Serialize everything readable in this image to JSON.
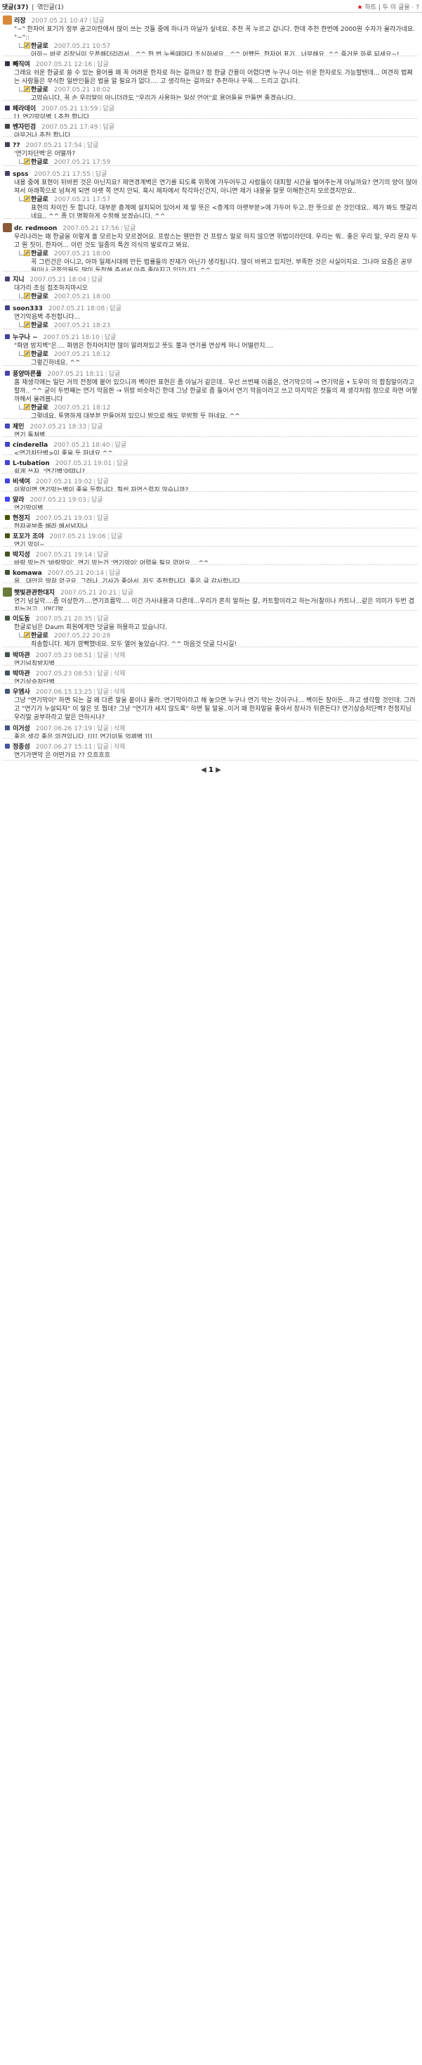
{
  "topbar": {
    "tab_comments": "댓글(37)",
    "tab_sep": "|",
    "tab_trackback": "엮인글(1)",
    "heart": "★",
    "heart_label": "하트",
    "share": "| 두 이 글을 · ?"
  },
  "comments": [
    {
      "nick": "리장",
      "date": "2007.05.21 10:47",
      "reply_link": "답글",
      "avatar": "#d88a3a",
      "text": "\"~\" 한자어 표기가 정부 공고이란에서 많이 쓰는 것들 중에 하나가 아닐가 싶네요. 추천 꼭 누르고 갑니다. 한데 추천 한번에 2000원 수자가 올라가네요. \"~\"::",
      "reply": {
        "nick": "한글로",
        "date": "2007.05.21 10:57",
        "text": "아하~ 바로 리장님이 오픈해더리라서.. ^^ 한 번 누를때마다 조심하세요.. ^^ 어쨌든. 한자어 표기.. 너무해요. ^^ 즐거운 하루 되세요~!"
      }
    },
    {
      "nick": "빼직여",
      "date": "2007.05.21 12:16",
      "reply_link": "답글",
      "avatar": "#334",
      "text": "그래요 쉬운 한글로 쓸 수 있는 용어를 왜 꼭 어려운 한자로 하는 걸까요? 정 한글 간용이 어렵다면 누구나 아는 쉬운 한자로도 가능할텐데... 여견히 법쪄는 사람들은 무식한 일반인들은 법을 알 필요가 없다.... 고 생각하는 걸까요? 추천하나 꾸욱... 드리고 갑니다.",
      "reply": {
        "nick": "한글로",
        "date": "2007.05.21 18:02",
        "text": "고맙습니다. 꼭 손 우리말이 아니더라도 \"우리가 사용하는 일상 언어\"로 용어들을 만들면 좋겠습니다."
      }
    },
    {
      "nick": "페라데이",
      "date": "2007.05.21 13:59",
      "reply_link": "답글",
      "avatar": "#335",
      "text": "[1.연기막이벽 ] 추천 합니다.",
      "reply": null
    },
    {
      "nick": "벤자민검",
      "date": "2007.05.21 17:49",
      "reply_link": "답글",
      "avatar": "#444",
      "text": "아무거나 추천 합니다.",
      "reply": null
    },
    {
      "nick": "??",
      "date": "2007.05.21 17:54",
      "reply_link": "답글",
      "avatar": "#445",
      "text": "'연기차단벽'은 어떨까?",
      "reply": {
        "nick": "한글로",
        "date": "2007.05.21 17:59",
        "text": "그것도 괜찮네요"
      }
    },
    {
      "nick": "spss",
      "date": "2007.05.21 17:55",
      "reply_link": "답글",
      "avatar": "#446",
      "text": "내용 중에 표현이 뒤바뀐 것은 아닌지요? 제연경계벽은 연기를 되도록 위쪽에 가두어두고 사람들이 대피할 시간을 벌어주는게 아닐까요? 연기의 양이 많아져서 아래쪽으로 넘쳐게 되면 아랫 쪽 연지 안되. 혹시 제자에서 착각하신건지, 아니면 제가 내용을 잘못 이해한건지 모르겠지만요..",
      "reply": {
        "nick": "한글로",
        "date": "2007.05.21 17:57",
        "text": "표현의 차이인 듯 합니다. 대부분 충계에 설치되어 있어서 제 말 뜻은 <층계의 아랫부분>에 가두어 두고..란 뜻으로 쓴 것인데요.. 제가 봐도 헷갈리네요.. ^^ 좀 더 명확하게 수정해 보겠습니다. ^^"
      }
    },
    {
      "nick": "dr. redmoon",
      "date": "2007.05.21 17:56",
      "reply_link": "답글",
      "avatar": "#8a5a3a",
      "text": "우리나라는 왜 한글을 이렇게 홀 모르는지 모르겠어요. 프랑스는 웬만한 건 프랑스 말로 하지 않으면 위법이라던데. 우리는 뭐.. 좋은 우리 말, 우리 문자 두고 뭔 짓이. 한자어... 이런 것도 일종의 특권 의식의 발로라고 봐요.",
      "reply": {
        "nick": "한글로",
        "date": "2007.05.21 18:00",
        "text": "꼭 그런건은 아니고, 아마 일제시대에 만든 법률들의 잔재가 아닌가 생각됩니다. 많이 바뀌고 있지만, 부족한 것은 사실이지요. 그나마 요즘은 공무원이나 국회의원도 많이 동참해 주셔서 아주 좋아지고 있답니다. ^^"
      }
    },
    {
      "nick": "지니",
      "date": "2007.05.21 18:04",
      "reply_link": "답글",
      "avatar": "#447",
      "text": "대가리 조심 접조하지마시오",
      "reply": {
        "nick": "한글로",
        "date": "2007.05.21 18:00",
        "text": "크... 주의하라는 뜻은 색깔만 봐도.. ^^"
      }
    },
    {
      "nick": "soon333",
      "date": "2007.05.21 18:08",
      "reply_link": "답글",
      "avatar": "#448",
      "text": "연기막음벽 추천합니다...",
      "reply": {
        "nick": "한글로",
        "date": "2007.05.21 18:23",
        "text": "네.. 무난하지요? ^^"
      }
    },
    {
      "nick": "누구나 ~",
      "date": "2007.05.21 18:10",
      "reply_link": "답글",
      "avatar": "#449",
      "text": "\"화염 방지벽\"은.... 화염은 한자어지만 많이 알려져있고 뜻도 불과 연기를 연상케 하니 어떨런지....",
      "reply": {
        "nick": "한글로",
        "date": "2007.05.21 18:12",
        "text": "그렇긴하네요. ^^"
      }
    },
    {
      "nick": "풍양마른풀",
      "date": "2007.05.21 18:11",
      "reply_link": "답글",
      "avatar": "#44a",
      "text": "홈 제생각에는 일단 거의 전정에 붙어 있으니까 벽이란 표현은 좀 아닐거 같은데.. 우선 쓰번째 이름은, 연기막으미 → 연기막음 • 도우미 의 합침말이라고 할까.. ^^ 굳이 두번째는 연기 막음판 → 위랑 비슷하긴 한데 그냥 한글로 좀 들어서 연기 막음이라고 쓰고 마지막은 컷들의 제 생각처럼 정으로 하면 어떻까해서 올려봅니다",
      "reply": {
        "nick": "한글로",
        "date": "2007.05.21 18:12",
        "text": "그렇네요. 투명하게 대부분 만들어져 있으니 방으로 해도 무방할 듯 하네요. ^^"
      }
    },
    {
      "nick": "제인",
      "date": "2007.05.21 18:33",
      "reply_link": "답글",
      "avatar": "#44b",
      "text": "연기 돌쳐벽..",
      "reply": null
    },
    {
      "nick": "cinderella",
      "date": "2007.05.21 18:40",
      "reply_link": "답글",
      "avatar": "#44c",
      "text": "<연기차단벽>이 좋을 듯 하네요.^^",
      "reply": null
    },
    {
      "nick": "L-tubation",
      "date": "2007.05.21 19:01",
      "reply_link": "답글",
      "avatar": "#44d",
      "text": "쉽게 쓰자. '연긴벽'어떠니?",
      "reply": null
    },
    {
      "nick": "비색여",
      "date": "2007.05.21 19:02",
      "reply_link": "답글",
      "avatar": "#44e",
      "text": "이왕이면 연기막는벽이 좋을 듯합니다. 훨씬 자연스럽지 않습니까?",
      "reply": null
    },
    {
      "nick": "알라",
      "date": "2007.05.21 19:03",
      "reply_link": "답글",
      "avatar": "#44f",
      "text": "연기막이벽",
      "reply": null
    },
    {
      "nick": "현정지",
      "date": "2007.05.21 19:03",
      "reply_link": "답글",
      "avatar": "#450",
      "text": "한자공부좀 해라 해서넘지나",
      "reply": null
    },
    {
      "nick": "포꼬가 조야",
      "date": "2007.05.21 19:06",
      "reply_link": "답글",
      "avatar": "#451",
      "text": "연기 막이~",
      "reply": null
    },
    {
      "nick": "박지성",
      "date": "2007.05.21 19:14",
      "reply_link": "답글",
      "avatar": "#452",
      "text": "바람 막는건 '바람막이', 연기 막는건 '연기막이' 어렵을 필요 없어요....^^",
      "reply": null
    },
    {
      "nick": "komawa",
      "date": "2007.05.21 20:14",
      "reply_link": "답글",
      "avatar": "#453",
      "text": "음.. 대안은 딱히 없구요. 그러나, 기사가 좋아서, 저도 추천합니다. 좋은 글 감사합니다.",
      "reply": null
    },
    {
      "nick": "햇빛관관한대지",
      "date": "2007.05.21 20:21",
      "reply_link": "답글",
      "avatar": "#6a7a3a",
      "text": "연기 넘실막....좀 이상한가....연기흐름막.... 이건 가사내용과 다른데...우리가 흔히 말하는 칼, 카트할이라고 하는거(찰이나 카트나...같은 의미가 두번 겹치는거고...)머디말...",
      "reply": null
    },
    {
      "nick": "이도동",
      "date": "2007.05.21 20:35",
      "reply_link": "답글",
      "avatar": "#454",
      "text": "한글로님은 Daum 회원에게만 덧글을 허용하고 있습니다.",
      "reply": {
        "nick": "한글로",
        "date": "2007.05.22 20:28",
        "text": "죄송합니다. 제가 깜빡했네요. 모두 열어 놓았습니다. ^^ 마음것 덧글 다시길!"
      }
    },
    {
      "nick": "박마관",
      "date": "2007.05.23 08:51",
      "reply_link": "답글",
      "extra_link": "삭제",
      "avatar": "#455",
      "text": "연기넘침방지벽",
      "reply": null
    },
    {
      "nick": "박마관",
      "date": "2007.05.23 08:53",
      "reply_link": "답글",
      "extra_link": "삭제",
      "avatar": "#456",
      "text": "연기상승저단벽",
      "reply": null
    },
    {
      "nick": "우엠사",
      "date": "2007.06.15 13:25",
      "reply_link": "답글",
      "extra_link": "삭제",
      "avatar": "#457",
      "text": "그냥 \"연기막이\" 하면 되는 걸 왜 다른 말을 붙이나 몰라. 연기막이라고 해 놓으면 누구나 연기 막는 것이구나... 벽이든 창이든...하고 생각할 것인데. 그러고 \"연기가 누설되자\" 이 말은 또 뭡데? 그냥 \"연기가 새지 않도록\" 하면 될 말을..이거 왜 한자말을 좋아서 장사가 뒤흔든다? 연기상승저단벽? 헌정지님 우리말 공부하라고 말은 안하시나?",
      "reply": null
    },
    {
      "nick": "이거성",
      "date": "2007.06.26 17:19",
      "reply_link": "답글",
      "extra_link": "삭제",
      "avatar": "#458",
      "text": "좋은 생각 좋은 의견입니다.  [[[[  연기이동 억제벽  ]]]",
      "reply": null
    },
    {
      "nick": "정종섬",
      "date": "2007.06.27 15:11",
      "reply_link": "답글",
      "extra_link": "삭제",
      "avatar": "#459",
      "text": "연기가면막 은 어떤가요 ?? 으흐흐흐",
      "reply": null
    }
  ],
  "pager": {
    "prev": "◀",
    "current": "1",
    "next": "▶"
  }
}
